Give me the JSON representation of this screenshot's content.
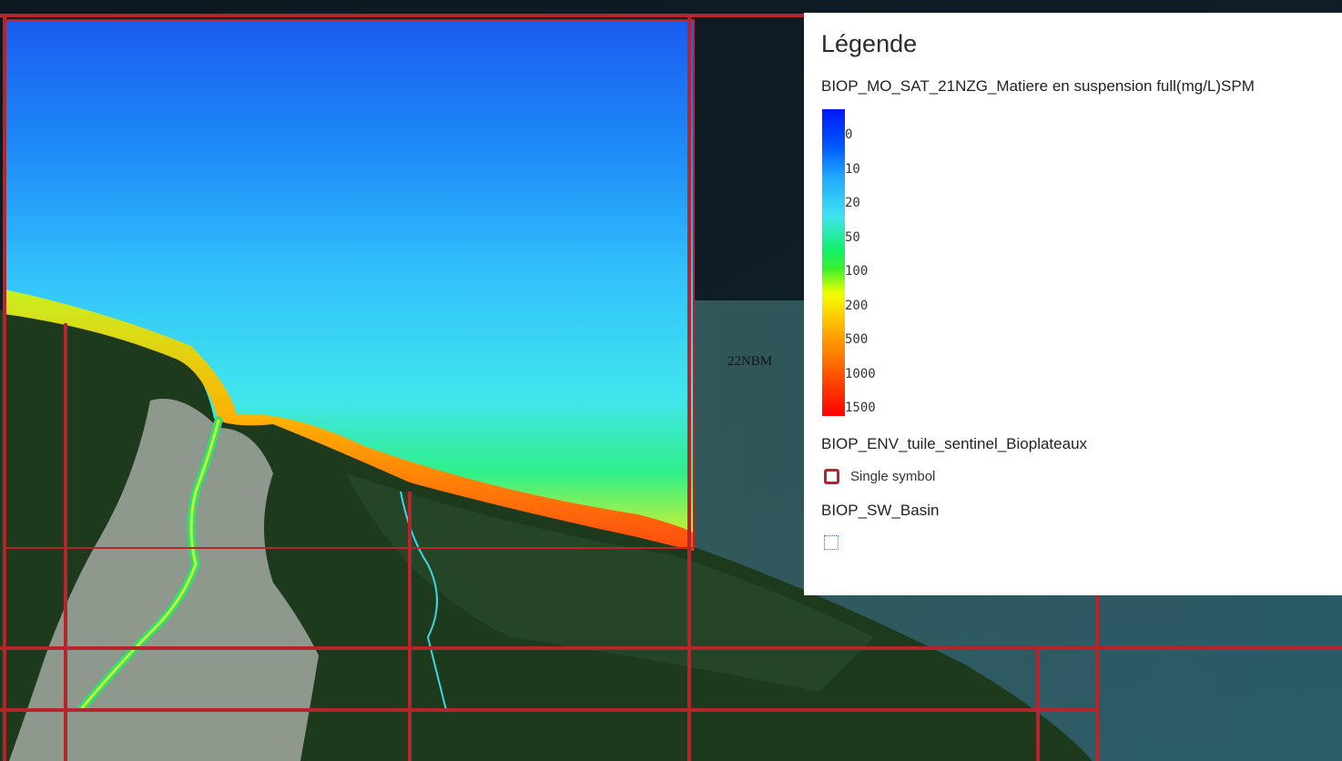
{
  "map": {
    "tile_label": "22NBM",
    "colors": {
      "tile_grid": "#b8242c",
      "forest": "#1f3a1e",
      "basin_fill": "#9aa39a",
      "ocean": "#1e3d4a"
    }
  },
  "legend": {
    "title": "Légende",
    "layers": [
      {
        "name": "BIOP_MO_SAT_21NZG_Matiere en suspension full(mg/L)SPM",
        "type": "color-ramp",
        "ramp_labels": [
          "0",
          "10",
          "20",
          "50",
          "100",
          "200",
          "500",
          "1000",
          "1500"
        ],
        "ramp_colors": [
          "#0016ff",
          "#0058ff",
          "#20a8ff",
          "#3fe3ee",
          "#12f06a",
          "#f0ff00",
          "#ffc800",
          "#ff6a00",
          "#ff0000"
        ]
      },
      {
        "name": "BIOP_ENV_tuile_sentinel_Bioplateaux",
        "type": "single-symbol",
        "symbol_label": "Single symbol",
        "symbol_color": "#c0202e"
      },
      {
        "name": "BIOP_SW_Basin",
        "type": "dotted-polygon",
        "symbol_color": "#4a6fd6"
      }
    ]
  }
}
